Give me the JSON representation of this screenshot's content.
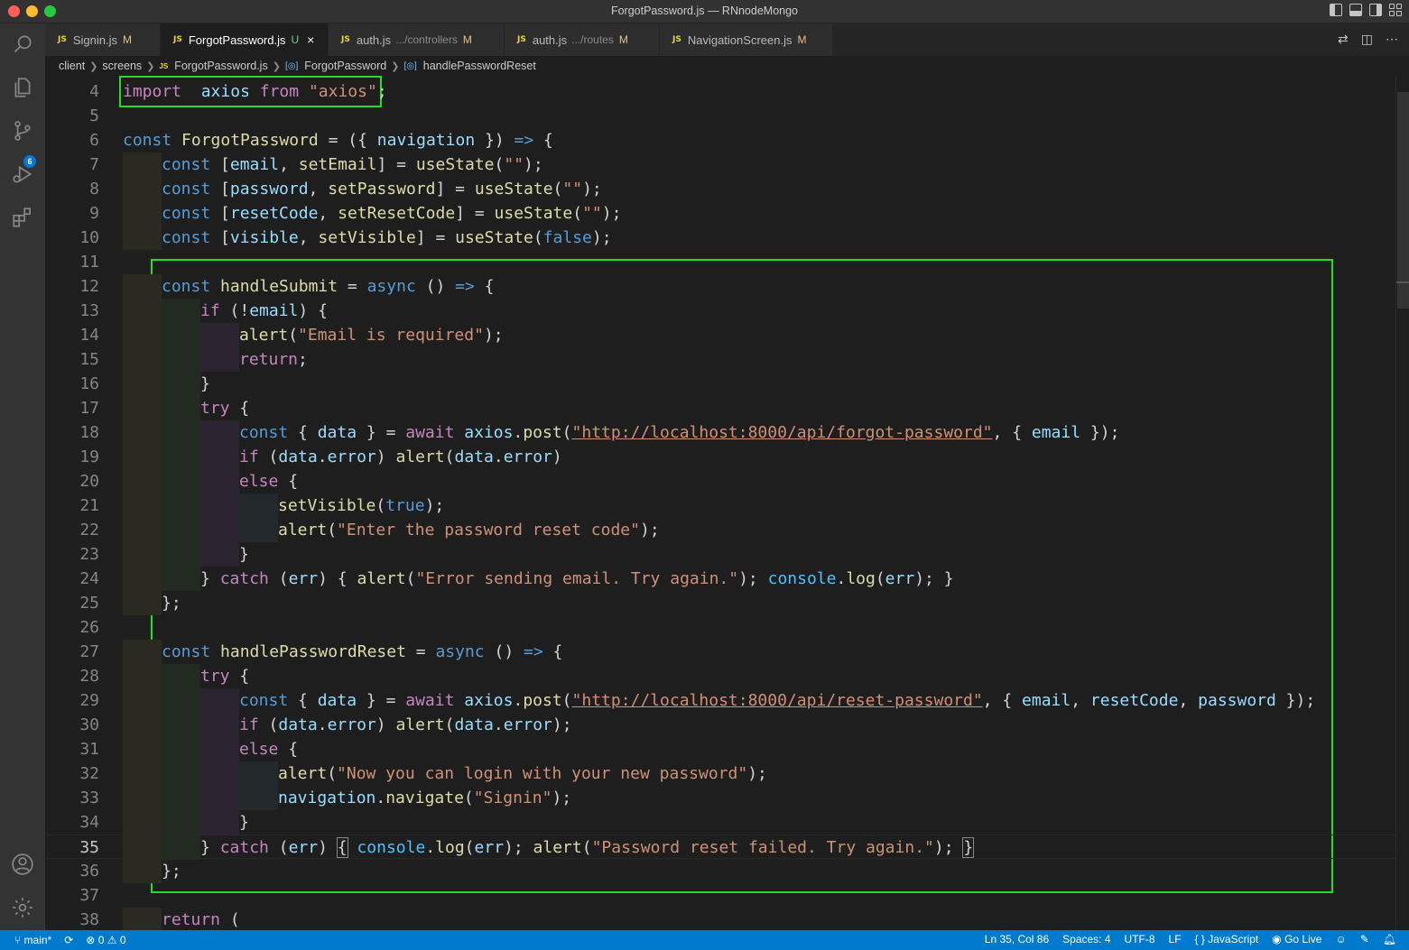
{
  "window": {
    "title": "ForgotPassword.js — RNnodeMongo"
  },
  "tabs": [
    {
      "name": "Signin.js",
      "dir": "",
      "status": "M",
      "active": false
    },
    {
      "name": "ForgotPassword.js",
      "dir": "",
      "status": "U",
      "active": true
    },
    {
      "name": "auth.js",
      "dir": ".../controllers",
      "status": "M",
      "active": false
    },
    {
      "name": "auth.js",
      "dir": ".../routes",
      "status": "M",
      "active": false
    },
    {
      "name": "NavigationScreen.js",
      "dir": "",
      "status": "M",
      "active": false
    }
  ],
  "tab_file_icon": "JS",
  "tab_close_glyph": "×",
  "breadcrumbs": {
    "seg1": "client",
    "seg2": "screens",
    "seg3": "ForgotPassword.js",
    "seg4": "ForgotPassword",
    "seg5": "handlePasswordReset"
  },
  "activity": {
    "scm_badge": "6"
  },
  "code_lines": [
    {
      "n": "4",
      "indent": 0,
      "tokens": [
        [
          "ctrl",
          "import"
        ],
        [
          "",
          "  "
        ],
        [
          "var",
          "axios"
        ],
        [
          "",
          " "
        ],
        [
          "ctrl",
          "from"
        ],
        [
          "",
          " "
        ],
        [
          "str",
          "\"axios\""
        ],
        [
          "",
          ";"
        ]
      ]
    },
    {
      "n": "5",
      "indent": 0,
      "tokens": []
    },
    {
      "n": "6",
      "indent": 0,
      "tokens": [
        [
          "kw",
          "const"
        ],
        [
          "",
          " "
        ],
        [
          "fn",
          "ForgotPassword"
        ],
        [
          "",
          " = ({ "
        ],
        [
          "var",
          "navigation"
        ],
        [
          "",
          " }) "
        ],
        [
          "kw",
          "=>"
        ],
        [
          "",
          " {"
        ]
      ]
    },
    {
      "n": "7",
      "indent": 1,
      "tokens": [
        [
          "kw",
          "const"
        ],
        [
          "",
          " ["
        ],
        [
          "var",
          "email"
        ],
        [
          "",
          ", "
        ],
        [
          "fn",
          "setEmail"
        ],
        [
          "",
          "] = "
        ],
        [
          "fn",
          "useState"
        ],
        [
          "",
          "("
        ],
        [
          "str",
          "\"\""
        ],
        [
          "",
          ");"
        ]
      ]
    },
    {
      "n": "8",
      "indent": 1,
      "tokens": [
        [
          "kw",
          "const"
        ],
        [
          "",
          " ["
        ],
        [
          "var",
          "password"
        ],
        [
          "",
          ", "
        ],
        [
          "fn",
          "setPassword"
        ],
        [
          "",
          "] = "
        ],
        [
          "fn",
          "useState"
        ],
        [
          "",
          "("
        ],
        [
          "str",
          "\"\""
        ],
        [
          "",
          ");"
        ]
      ]
    },
    {
      "n": "9",
      "indent": 1,
      "tokens": [
        [
          "kw",
          "const"
        ],
        [
          "",
          " ["
        ],
        [
          "var",
          "resetCode"
        ],
        [
          "",
          ", "
        ],
        [
          "fn",
          "setResetCode"
        ],
        [
          "",
          "] = "
        ],
        [
          "fn",
          "useState"
        ],
        [
          "",
          "("
        ],
        [
          "str",
          "\"\""
        ],
        [
          "",
          ");"
        ]
      ]
    },
    {
      "n": "10",
      "indent": 1,
      "tokens": [
        [
          "kw",
          "const"
        ],
        [
          "",
          " ["
        ],
        [
          "var",
          "visible"
        ],
        [
          "",
          ", "
        ],
        [
          "fn",
          "setVisible"
        ],
        [
          "",
          "] = "
        ],
        [
          "fn",
          "useState"
        ],
        [
          "",
          "("
        ],
        [
          "const",
          "false"
        ],
        [
          "",
          ");"
        ]
      ]
    },
    {
      "n": "11",
      "indent": 0,
      "tokens": []
    },
    {
      "n": "12",
      "indent": 1,
      "tokens": [
        [
          "kw",
          "const"
        ],
        [
          "",
          " "
        ],
        [
          "fn",
          "handleSubmit"
        ],
        [
          "",
          " = "
        ],
        [
          "kw",
          "async"
        ],
        [
          "",
          " () "
        ],
        [
          "kw",
          "=>"
        ],
        [
          "",
          " {"
        ]
      ]
    },
    {
      "n": "13",
      "indent": 2,
      "tokens": [
        [
          "ctrl",
          "if"
        ],
        [
          "",
          " (!"
        ],
        [
          "var",
          "email"
        ],
        [
          "",
          ") {"
        ]
      ]
    },
    {
      "n": "14",
      "indent": 3,
      "tokens": [
        [
          "fn",
          "alert"
        ],
        [
          "",
          "("
        ],
        [
          "str",
          "\"Email is required\""
        ],
        [
          "",
          ");"
        ]
      ]
    },
    {
      "n": "15",
      "indent": 3,
      "tokens": [
        [
          "ctrl",
          "return"
        ],
        [
          "",
          ";"
        ]
      ]
    },
    {
      "n": "16",
      "indent": 2,
      "tokens": [
        [
          "",
          "}"
        ]
      ]
    },
    {
      "n": "17",
      "indent": 2,
      "tokens": [
        [
          "ctrl",
          "try"
        ],
        [
          "",
          " {"
        ]
      ]
    },
    {
      "n": "18",
      "indent": 3,
      "tokens": [
        [
          "kw",
          "const"
        ],
        [
          "",
          " { "
        ],
        [
          "var",
          "data"
        ],
        [
          "",
          " } = "
        ],
        [
          "ctrl",
          "await"
        ],
        [
          "",
          " "
        ],
        [
          "var",
          "axios"
        ],
        [
          "",
          "."
        ],
        [
          "fn",
          "post"
        ],
        [
          "",
          "("
        ],
        [
          "url",
          "\"http://localhost:8000/api/forgot-password\""
        ],
        [
          "",
          ", { "
        ],
        [
          "var",
          "email"
        ],
        [
          "",
          " });"
        ]
      ]
    },
    {
      "n": "19",
      "indent": 3,
      "tokens": [
        [
          "ctrl",
          "if"
        ],
        [
          "",
          " ("
        ],
        [
          "var",
          "data"
        ],
        [
          "",
          "."
        ],
        [
          "var",
          "error"
        ],
        [
          "",
          ") "
        ],
        [
          "fn",
          "alert"
        ],
        [
          "",
          "("
        ],
        [
          "var",
          "data"
        ],
        [
          "",
          "."
        ],
        [
          "var",
          "error"
        ],
        [
          "",
          ")"
        ]
      ]
    },
    {
      "n": "20",
      "indent": 3,
      "tokens": [
        [
          "ctrl",
          "else"
        ],
        [
          "",
          " {"
        ]
      ]
    },
    {
      "n": "21",
      "indent": 4,
      "tokens": [
        [
          "fn",
          "setVisible"
        ],
        [
          "",
          "("
        ],
        [
          "const",
          "true"
        ],
        [
          "",
          ");"
        ]
      ]
    },
    {
      "n": "22",
      "indent": 4,
      "tokens": [
        [
          "fn",
          "alert"
        ],
        [
          "",
          "("
        ],
        [
          "str",
          "\"Enter the password reset code\""
        ],
        [
          "",
          ");"
        ]
      ]
    },
    {
      "n": "23",
      "indent": 3,
      "tokens": [
        [
          "",
          "}"
        ]
      ]
    },
    {
      "n": "24",
      "indent": 2,
      "tokens": [
        [
          "",
          "} "
        ],
        [
          "ctrl",
          "catch"
        ],
        [
          "",
          " ("
        ],
        [
          "var",
          "err"
        ],
        [
          "",
          ") { "
        ],
        [
          "fn",
          "alert"
        ],
        [
          "",
          "("
        ],
        [
          "str",
          "\"Error sending email. Try again.\""
        ],
        [
          "",
          "); "
        ],
        [
          "obj",
          "console"
        ],
        [
          "",
          "."
        ],
        [
          "fn",
          "log"
        ],
        [
          "",
          "("
        ],
        [
          "var",
          "err"
        ],
        [
          "",
          "); }"
        ]
      ]
    },
    {
      "n": "25",
      "indent": 1,
      "tokens": [
        [
          "",
          "};"
        ]
      ]
    },
    {
      "n": "26",
      "indent": 0,
      "tokens": []
    },
    {
      "n": "27",
      "indent": 1,
      "tokens": [
        [
          "kw",
          "const"
        ],
        [
          "",
          " "
        ],
        [
          "fn",
          "handlePasswordReset"
        ],
        [
          "",
          " = "
        ],
        [
          "kw",
          "async"
        ],
        [
          "",
          " () "
        ],
        [
          "kw",
          "=>"
        ],
        [
          "",
          " {"
        ]
      ]
    },
    {
      "n": "28",
      "indent": 2,
      "tokens": [
        [
          "ctrl",
          "try"
        ],
        [
          "",
          " {"
        ]
      ]
    },
    {
      "n": "29",
      "indent": 3,
      "tokens": [
        [
          "kw",
          "const"
        ],
        [
          "",
          " { "
        ],
        [
          "var",
          "data"
        ],
        [
          "",
          " } = "
        ],
        [
          "ctrl",
          "await"
        ],
        [
          "",
          " "
        ],
        [
          "var",
          "axios"
        ],
        [
          "",
          "."
        ],
        [
          "fn",
          "post"
        ],
        [
          "",
          "("
        ],
        [
          "url",
          "\"http://localhost:8000/api/reset-password\""
        ],
        [
          "",
          ", { "
        ],
        [
          "var",
          "email"
        ],
        [
          "",
          ", "
        ],
        [
          "var",
          "resetCode"
        ],
        [
          "",
          ", "
        ],
        [
          "var",
          "password"
        ],
        [
          "",
          " });"
        ]
      ]
    },
    {
      "n": "30",
      "indent": 3,
      "tokens": [
        [
          "ctrl",
          "if"
        ],
        [
          "",
          " ("
        ],
        [
          "var",
          "data"
        ],
        [
          "",
          "."
        ],
        [
          "var",
          "error"
        ],
        [
          "",
          ") "
        ],
        [
          "fn",
          "alert"
        ],
        [
          "",
          "("
        ],
        [
          "var",
          "data"
        ],
        [
          "",
          "."
        ],
        [
          "var",
          "error"
        ],
        [
          "",
          ");"
        ]
      ]
    },
    {
      "n": "31",
      "indent": 3,
      "tokens": [
        [
          "ctrl",
          "else"
        ],
        [
          "",
          " {"
        ]
      ]
    },
    {
      "n": "32",
      "indent": 4,
      "tokens": [
        [
          "fn",
          "alert"
        ],
        [
          "",
          "("
        ],
        [
          "str",
          "\"Now you can login with your new password\""
        ],
        [
          "",
          ");"
        ]
      ]
    },
    {
      "n": "33",
      "indent": 4,
      "tokens": [
        [
          "var",
          "navigation"
        ],
        [
          "",
          "."
        ],
        [
          "fn",
          "navigate"
        ],
        [
          "",
          "("
        ],
        [
          "str",
          "\"Signin\""
        ],
        [
          "",
          ");"
        ]
      ]
    },
    {
      "n": "34",
      "indent": 3,
      "tokens": [
        [
          "",
          "}"
        ]
      ]
    },
    {
      "n": "35",
      "indent": 2,
      "current": true,
      "tokens": [
        [
          "",
          "} "
        ],
        [
          "ctrl",
          "catch"
        ],
        [
          "",
          " ("
        ],
        [
          "var",
          "err"
        ],
        [
          "",
          ") "
        ],
        [
          "hl",
          "{"
        ],
        [
          "",
          " "
        ],
        [
          "obj",
          "console"
        ],
        [
          "",
          "."
        ],
        [
          "fn",
          "log"
        ],
        [
          "",
          "("
        ],
        [
          "var",
          "err"
        ],
        [
          "",
          "); "
        ],
        [
          "fn",
          "alert"
        ],
        [
          "",
          "("
        ],
        [
          "str",
          "\"Password reset failed. Try again.\""
        ],
        [
          "",
          "); "
        ],
        [
          "hl",
          "}"
        ]
      ]
    },
    {
      "n": "36",
      "indent": 1,
      "tokens": [
        [
          "",
          "};"
        ]
      ]
    },
    {
      "n": "37",
      "indent": 0,
      "tokens": []
    },
    {
      "n": "38",
      "indent": 1,
      "tokens": [
        [
          "ctrl",
          "return"
        ],
        [
          "",
          " ("
        ]
      ]
    }
  ],
  "colors": {
    "highlight_box": "#22dd22",
    "status_bar": "#007acc",
    "keyword": "#569cd6",
    "control": "#c586c0",
    "function": "#dcdcaa",
    "variable": "#9cdcfe",
    "string": "#ce9178"
  },
  "status": {
    "branch": "main*",
    "errors": "0",
    "warnings": "0",
    "position": "Ln 35, Col 86",
    "spaces": "Spaces: 4",
    "encoding": "UTF-8",
    "eol": "LF",
    "language": "JavaScript",
    "golive": "Go Live"
  }
}
